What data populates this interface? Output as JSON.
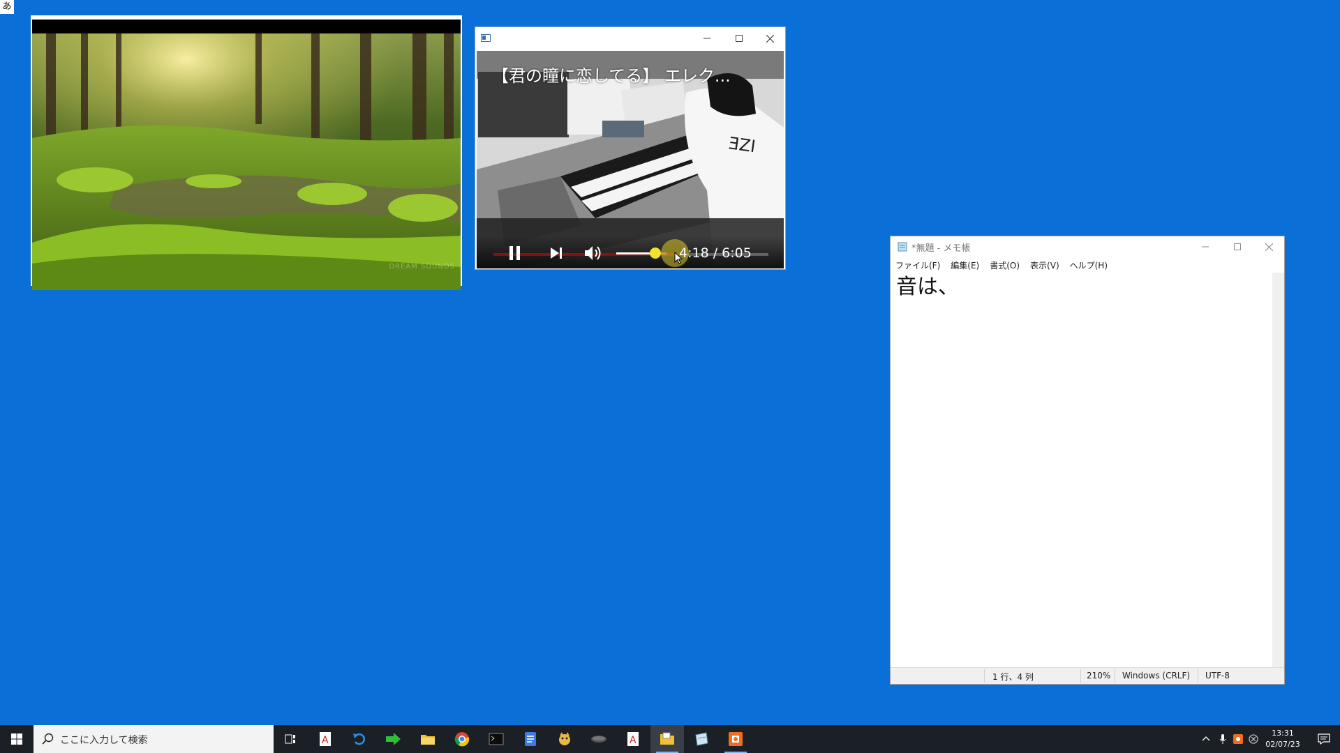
{
  "ime": {
    "indicator": "あ"
  },
  "nature_window": {
    "watermark": "DREAM SOUNDS"
  },
  "player": {
    "video_title": "【君の瞳に恋してる】 エレク...",
    "time": "4:18 / 6:05",
    "progress_fraction": 0.705,
    "volume_fraction": 0.78,
    "accent": "#e52020",
    "knob_color": "#f2e22a"
  },
  "notepad": {
    "title": "*無題 - メモ帳",
    "menu": [
      "ファイル(F)",
      "編集(E)",
      "書式(O)",
      "表示(V)",
      "ヘルプ(H)"
    ],
    "content": "音は、",
    "status": {
      "position": "1 行、4 列",
      "zoom": "210%",
      "line_ending": "Windows (CRLF)",
      "encoding": "UTF-8"
    }
  },
  "taskbar": {
    "search_placeholder": "ここに入力して検索",
    "clock_time": "13:31",
    "clock_date": "02/07/23",
    "apps": [
      "task-view",
      "acrobat",
      "undo",
      "arrow",
      "file-explorer",
      "chrome",
      "terminal",
      "docs",
      "character",
      "mouse",
      "acrobat-2",
      "explorer-active",
      "scanner",
      "orange-app"
    ]
  }
}
